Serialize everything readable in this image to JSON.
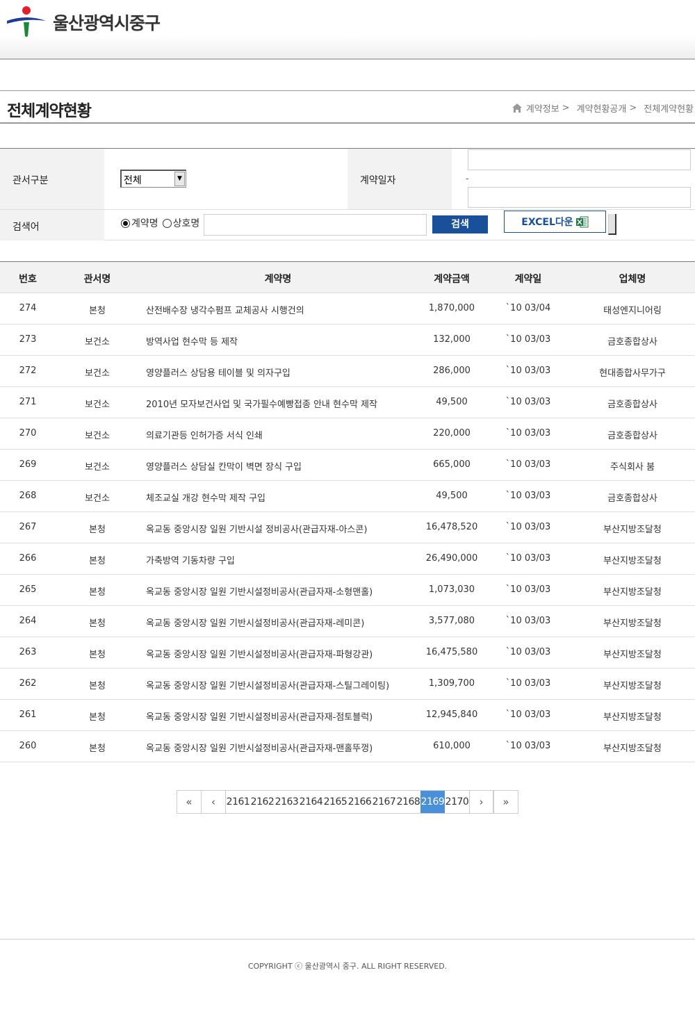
{
  "header": {
    "site_name": "울산광역시중구"
  },
  "page": {
    "title": "전체계약현황",
    "breadcrumb": [
      "계약정보",
      "계약현황공개",
      "전체계약현황"
    ],
    "breadcrumb_sep": ">"
  },
  "search": {
    "office_label": "관서구분",
    "office_value": "전체",
    "date_label": "계약일자",
    "date_sep": "-",
    "keyword_label": "검색어",
    "radio_contract": "계약명",
    "radio_company": "상호명",
    "search_button": "검색",
    "excel_button": "EXCEL다운"
  },
  "table": {
    "headers": [
      "번호",
      "관서명",
      "계약명",
      "계약금액",
      "계약일",
      "업체명"
    ],
    "rows": [
      [
        "274",
        "본청",
        "산전배수장 냉각수펌프 교체공사 시행건의",
        "1,870,000",
        "`10 03/04",
        "태성엔지니어링"
      ],
      [
        "273",
        "보건소",
        "방역사업 현수막 등 제작",
        "132,000",
        "`10 03/03",
        "금호종합상사"
      ],
      [
        "272",
        "보건소",
        "영양플러스 상담용 테이블 및 의자구입",
        "286,000",
        "`10 03/03",
        "현대종합사무가구"
      ],
      [
        "271",
        "보건소",
        "2010년 모자보건사업 및 국가필수예빵접종 안내 현수막 제작",
        "49,500",
        "`10 03/03",
        "금호종합상사"
      ],
      [
        "270",
        "보건소",
        "의료기관등 인허가증 서식 인쇄",
        "220,000",
        "`10 03/03",
        "금호종합상사"
      ],
      [
        "269",
        "보건소",
        "영양플러스 상담실 칸막이 벽면 장식 구입",
        "665,000",
        "`10 03/03",
        "주식회사 붐"
      ],
      [
        "268",
        "보건소",
        "체조교실 개강 현수막 제작 구입",
        "49,500",
        "`10 03/03",
        "금호종합상사"
      ],
      [
        "267",
        "본청",
        "옥교동 중앙시장 일원 기반시설 정비공사(관급자재-아스콘)",
        "16,478,520",
        "`10 03/03",
        "부산지방조달청"
      ],
      [
        "266",
        "본청",
        "가축방역 기동차량 구입",
        "26,490,000",
        "`10 03/03",
        "부산지방조달청"
      ],
      [
        "265",
        "본청",
        "옥교동 중앙시장 일원 기반시설정비공사(관급자재-소형맨홀)",
        "1,073,030",
        "`10 03/03",
        "부산지방조달청"
      ],
      [
        "264",
        "본청",
        "옥교동 중앙시장 일원 기반시설정비공사(관급자재-레미콘)",
        "3,577,080",
        "`10 03/03",
        "부산지방조달청"
      ],
      [
        "263",
        "본청",
        "옥교동 중앙시장 일원 기반시설정비공사(관급자재-파형강관)",
        "16,475,580",
        "`10 03/03",
        "부산지방조달청"
      ],
      [
        "262",
        "본청",
        "옥교동 중앙시장 일원 기반시설정비공사(관급자재-스틸그레이팅)",
        "1,309,700",
        "`10 03/03",
        "부산지방조달청"
      ],
      [
        "261",
        "본청",
        "옥교동 중앙시장 일원 기반시설정비공사(관급자재-점토블럭)",
        "12,945,840",
        "`10 03/03",
        "부산지방조달청"
      ],
      [
        "260",
        "본청",
        "옥교동 중앙시장 일원 기반시설정비공사(관급자재-맨홀뚜껑)",
        "610,000",
        "`10 03/03",
        "부산지방조달청"
      ]
    ]
  },
  "pagination": {
    "first": "«",
    "prev": "‹",
    "pages": [
      "2161",
      "2162",
      "2163",
      "2164",
      "2165",
      "2166",
      "2167",
      "2168",
      "2169",
      "2170"
    ],
    "active": "2169",
    "next": "›",
    "last": "»"
  },
  "footer": {
    "copyright": "COPYRIGHT ⓒ 울산광역시 중구. ALL RIGHT RESERVED."
  },
  "colors": {
    "accent": "#1a4f9a",
    "active_page": "#4a90d9",
    "logo_red": "#e0202a",
    "logo_blue": "#1e3c96",
    "logo_green": "#1a8a3a"
  }
}
